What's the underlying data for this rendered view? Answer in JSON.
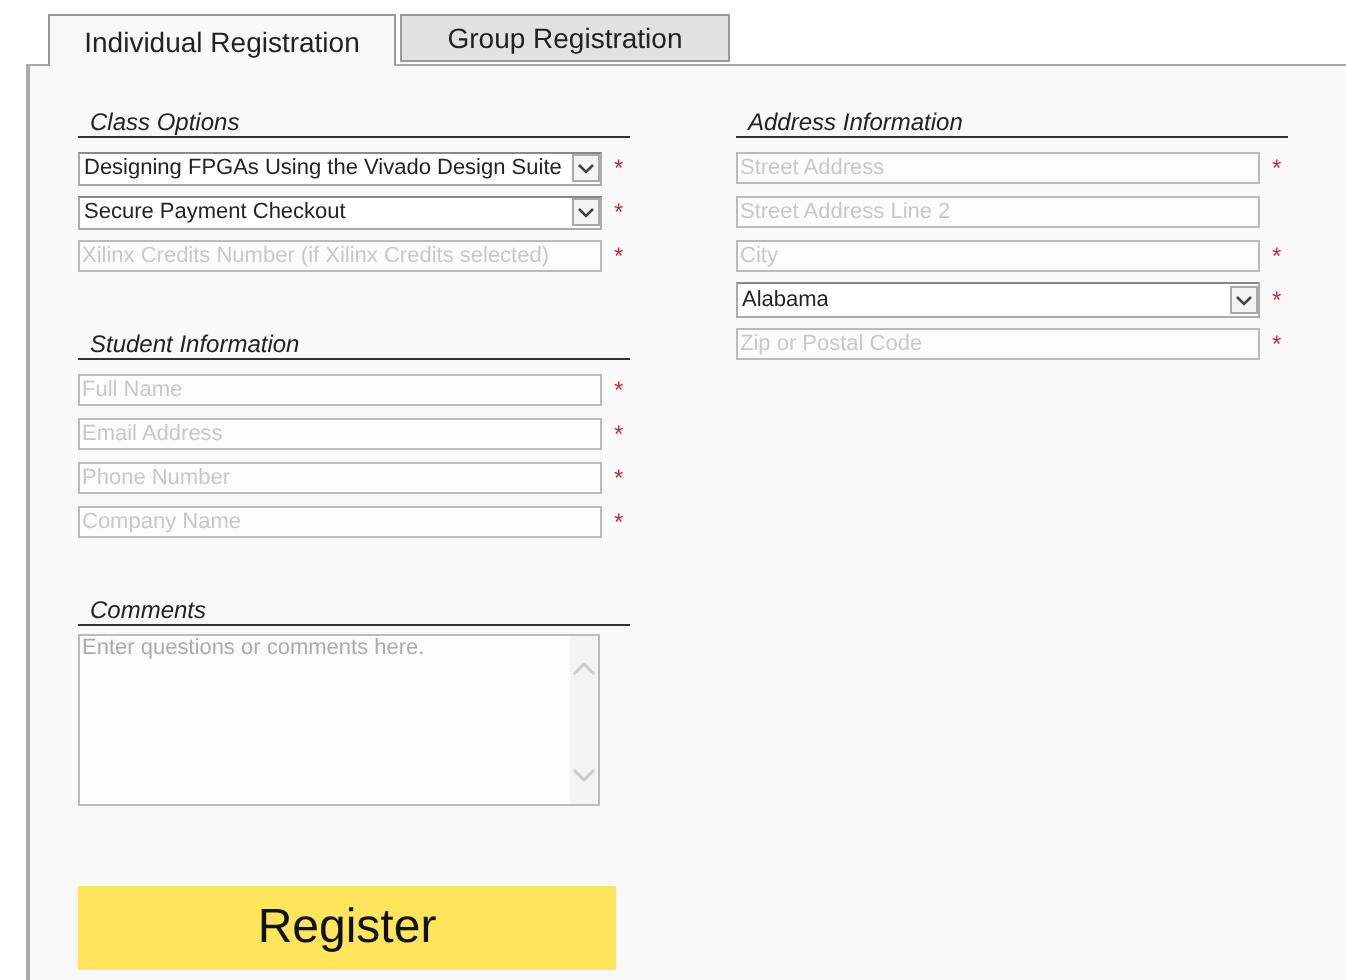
{
  "tabs": [
    {
      "label": "Individual Registration",
      "selected": true
    },
    {
      "label": "Group Registration",
      "selected": false
    }
  ],
  "class_options": {
    "title": "Class Options",
    "fields": [
      {
        "kind": "select",
        "value": "Designing FPGAs Using the Vivado Design Suite",
        "required_mark": "*"
      },
      {
        "kind": "select",
        "value": "Secure Payment Checkout",
        "required_mark": "*"
      },
      {
        "kind": "text",
        "placeholder": "Xilinx Credits Number (if Xilinx Credits selected)",
        "required_mark": "*"
      }
    ]
  },
  "student_information": {
    "title": "Student Information",
    "fields": [
      {
        "kind": "text",
        "placeholder": "Full Name",
        "required_mark": "*"
      },
      {
        "kind": "text",
        "placeholder": "Email Address",
        "required_mark": "*"
      },
      {
        "kind": "text",
        "placeholder": "Phone Number",
        "required_mark": "*"
      },
      {
        "kind": "text",
        "placeholder": "Company Name",
        "required_mark": "*"
      }
    ]
  },
  "comments": {
    "title": "Comments",
    "placeholder": "Enter questions or comments here."
  },
  "register_button": "Register",
  "address_information": {
    "title": "Address Information",
    "fields": [
      {
        "kind": "text",
        "placeholder": "Street Address",
        "required_mark": "*"
      },
      {
        "kind": "text",
        "placeholder": "Street Address Line 2"
      },
      {
        "kind": "text",
        "placeholder": "City",
        "required_mark": "*"
      },
      {
        "kind": "select",
        "value": "Alabama",
        "required_mark": "*"
      },
      {
        "kind": "text",
        "placeholder": "Zip or Postal Code",
        "required_mark": "*"
      }
    ]
  }
}
